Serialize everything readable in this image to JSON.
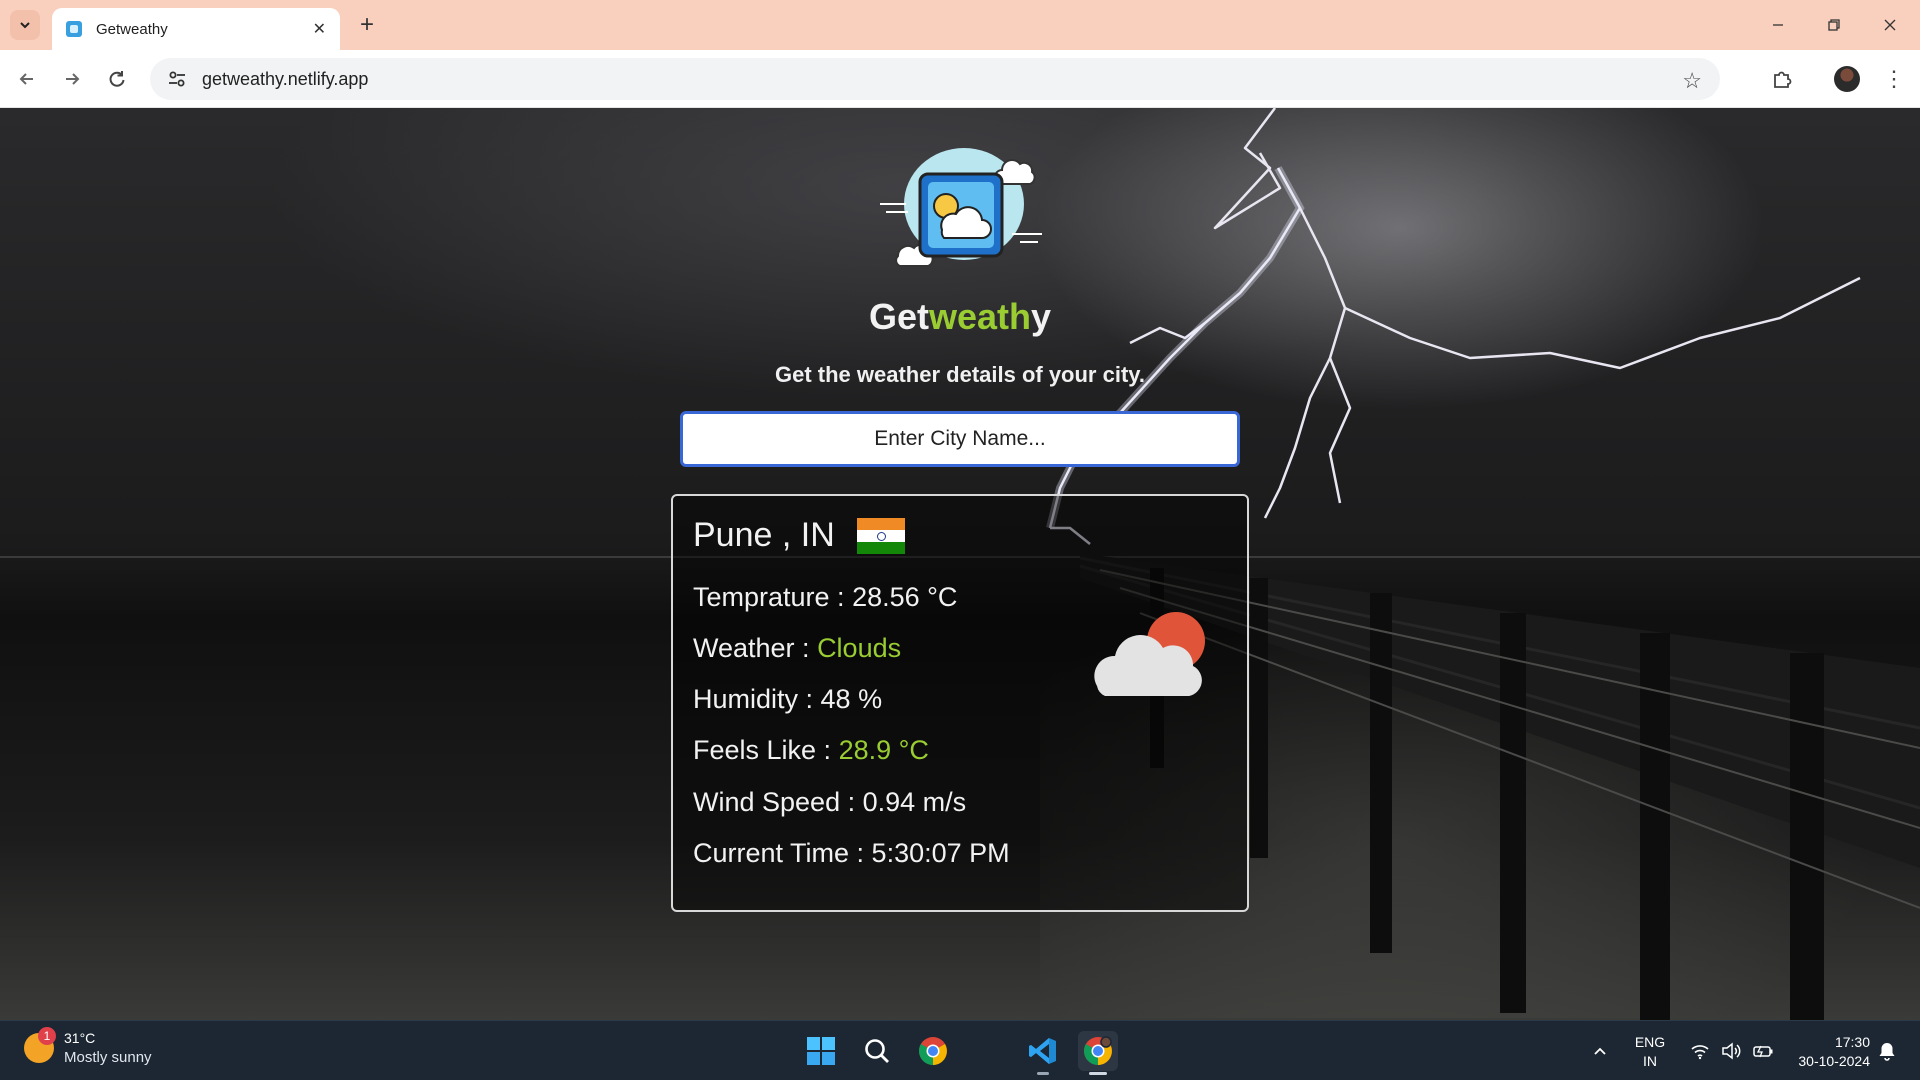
{
  "browser": {
    "tab_title": "Getweathy",
    "url": "getweathy.netlify.app",
    "icons": {
      "tab_search": "chevron-down-icon",
      "close_tab": "close-icon",
      "new_tab": "plus-icon",
      "back": "arrow-left-icon",
      "forward": "arrow-right-icon",
      "reload": "reload-icon",
      "site_info": "tune-icon",
      "bookmark": "star-icon",
      "extensions": "puzzle-icon",
      "menu": "kebab-menu-icon"
    }
  },
  "page": {
    "brand_prefix": "Get",
    "brand_accent": "weath",
    "brand_suffix": "y",
    "tagline": "Get the weather details of your city.",
    "search_placeholder": "Enter City Name...",
    "accent_color": "#9acd32"
  },
  "weather": {
    "city": "Pune , IN",
    "temperature_label": "Temprature : ",
    "temperature_value": "28.56 °C",
    "weather_label": "Weather : ",
    "weather_value": "Clouds",
    "humidity_label": "Humidity : ",
    "humidity_value": "48 %",
    "feels_like_label": "Feels Like : ",
    "feels_like_value": "28.9 °C",
    "wind_label": "Wind Speed : ",
    "wind_value": "0.94 m/s",
    "time_label": "Current Time : ",
    "time_value": "5:30:07 PM"
  },
  "taskbar": {
    "weather_badge": "1",
    "weather_temp": "31°C",
    "weather_cond": "Mostly sunny",
    "lang_top": "ENG",
    "lang_bottom": "IN",
    "time": "17:30",
    "date": "30-10-2024"
  }
}
